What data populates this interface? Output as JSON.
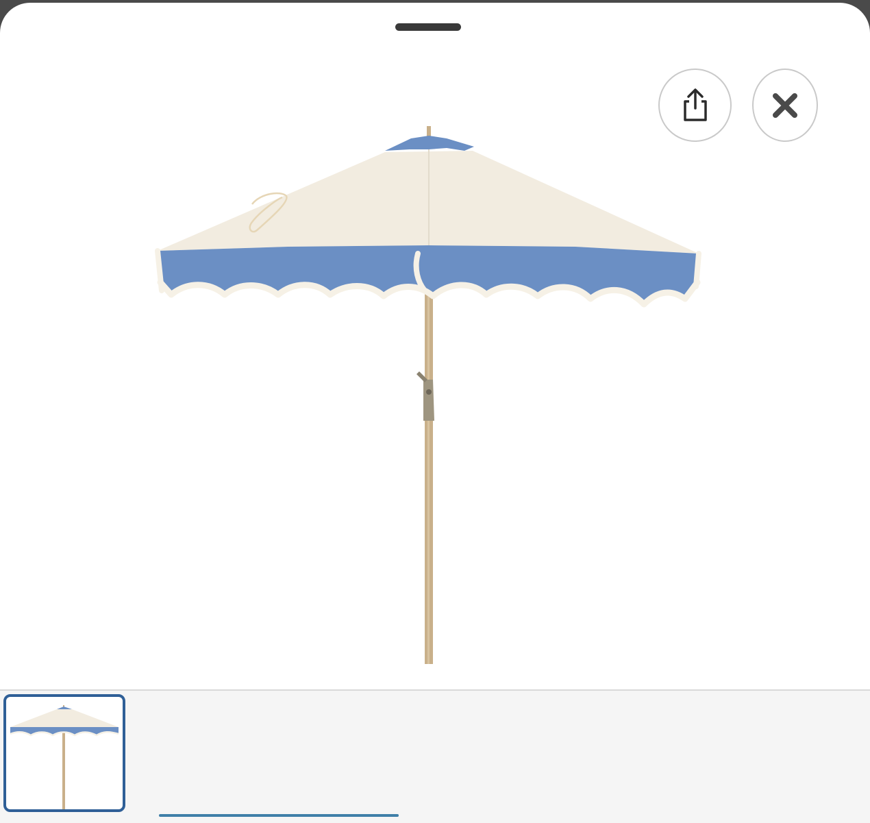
{
  "sheet": {
    "grabber": "drag-handle",
    "actions": {
      "share_icon": "share-icon",
      "close_icon": "close-icon"
    }
  },
  "product_image": {
    "subject": "umbrella",
    "colors": {
      "canopy": "#f2ece0",
      "valance": "#6b8fc4",
      "fringe": "#f6f1e6",
      "pole": "#c9b08a",
      "crank": "#9e9580"
    }
  },
  "thumbnails": {
    "selected_index": 0,
    "items": [
      {
        "subject": "umbrella"
      }
    ],
    "accent": "#2f5f97"
  }
}
